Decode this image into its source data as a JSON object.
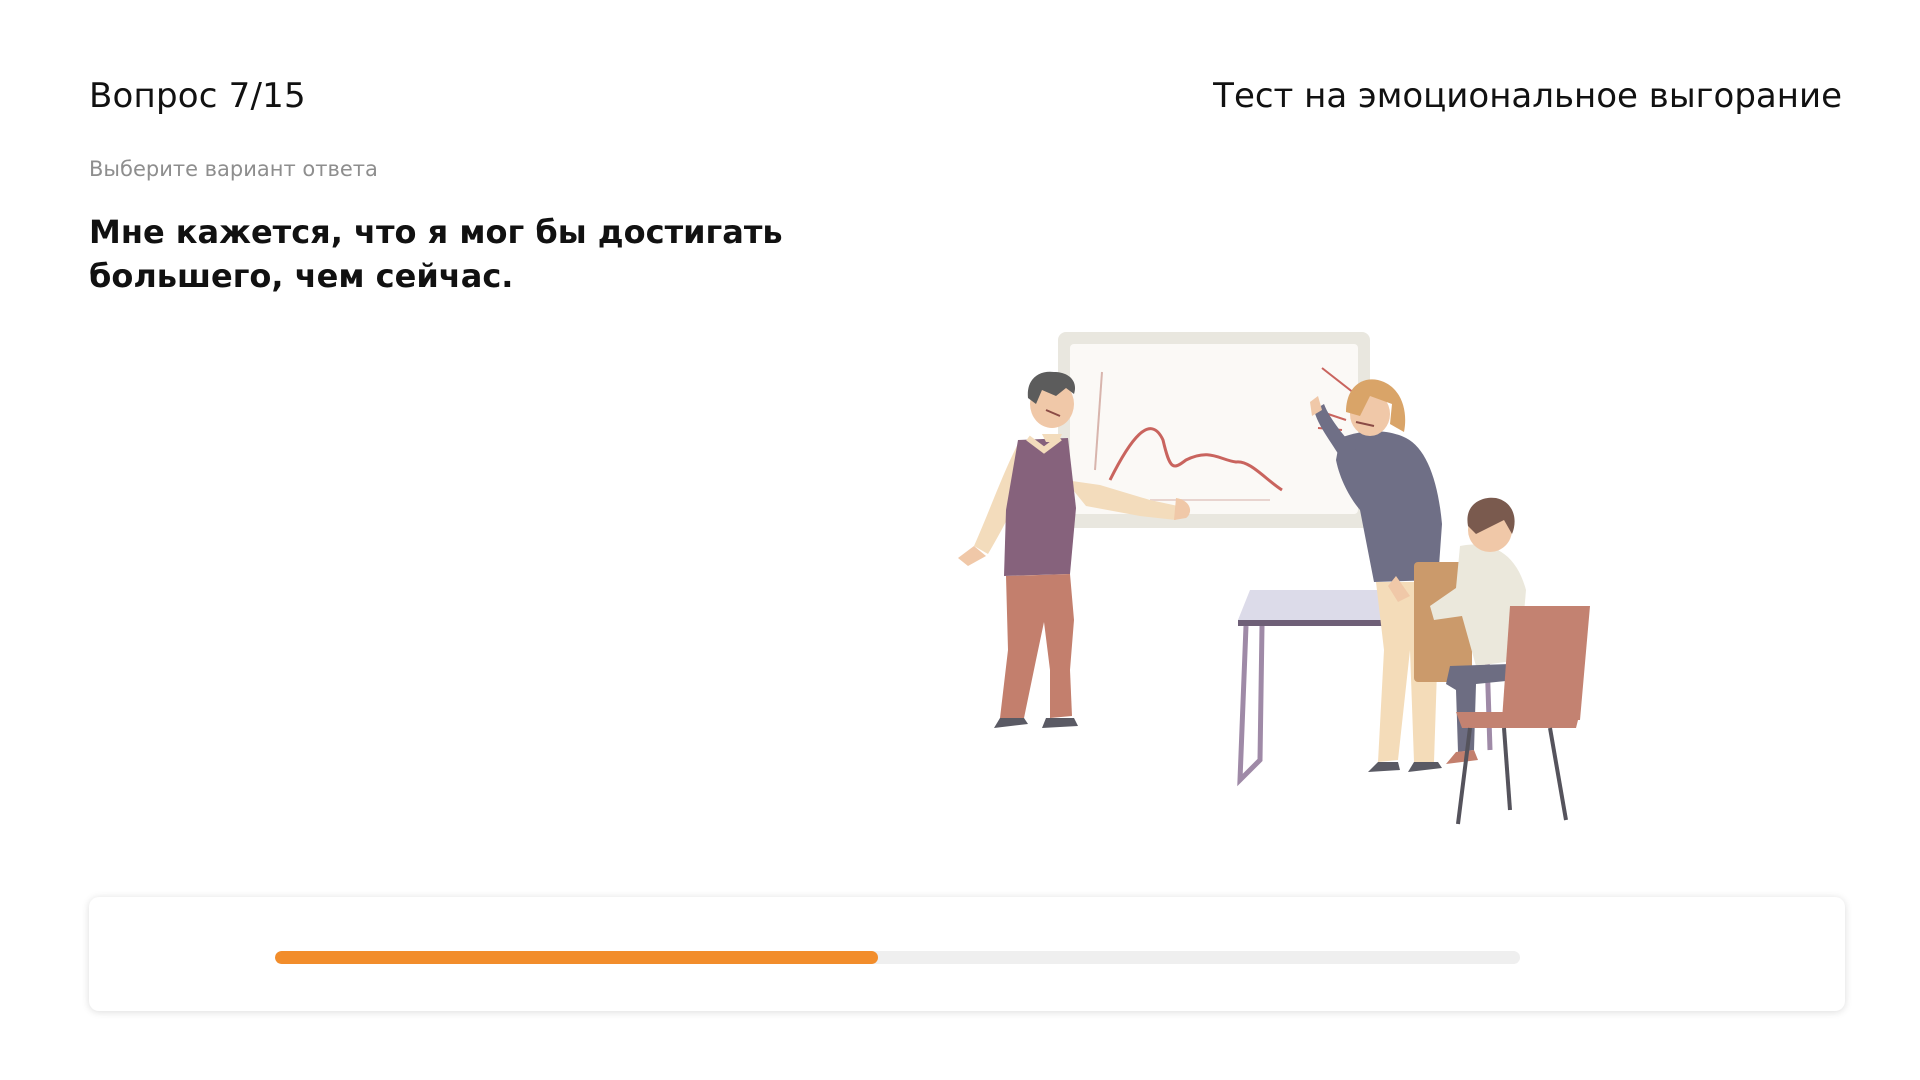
{
  "header": {
    "question_counter": "Вопрос 7/15",
    "test_title": "Тест на эмоциональное выгорание"
  },
  "question": {
    "instruction": "Выберите вариант ответа",
    "text": "Мне кажется, что я мог бы достигать большего, чем сейчас."
  },
  "progress": {
    "current": 7,
    "total": 15,
    "fraction": 0.484,
    "fill_color": "#f28d2b",
    "track_color": "#efefef"
  },
  "illustration": {
    "icon": "office-argument-illustration"
  }
}
